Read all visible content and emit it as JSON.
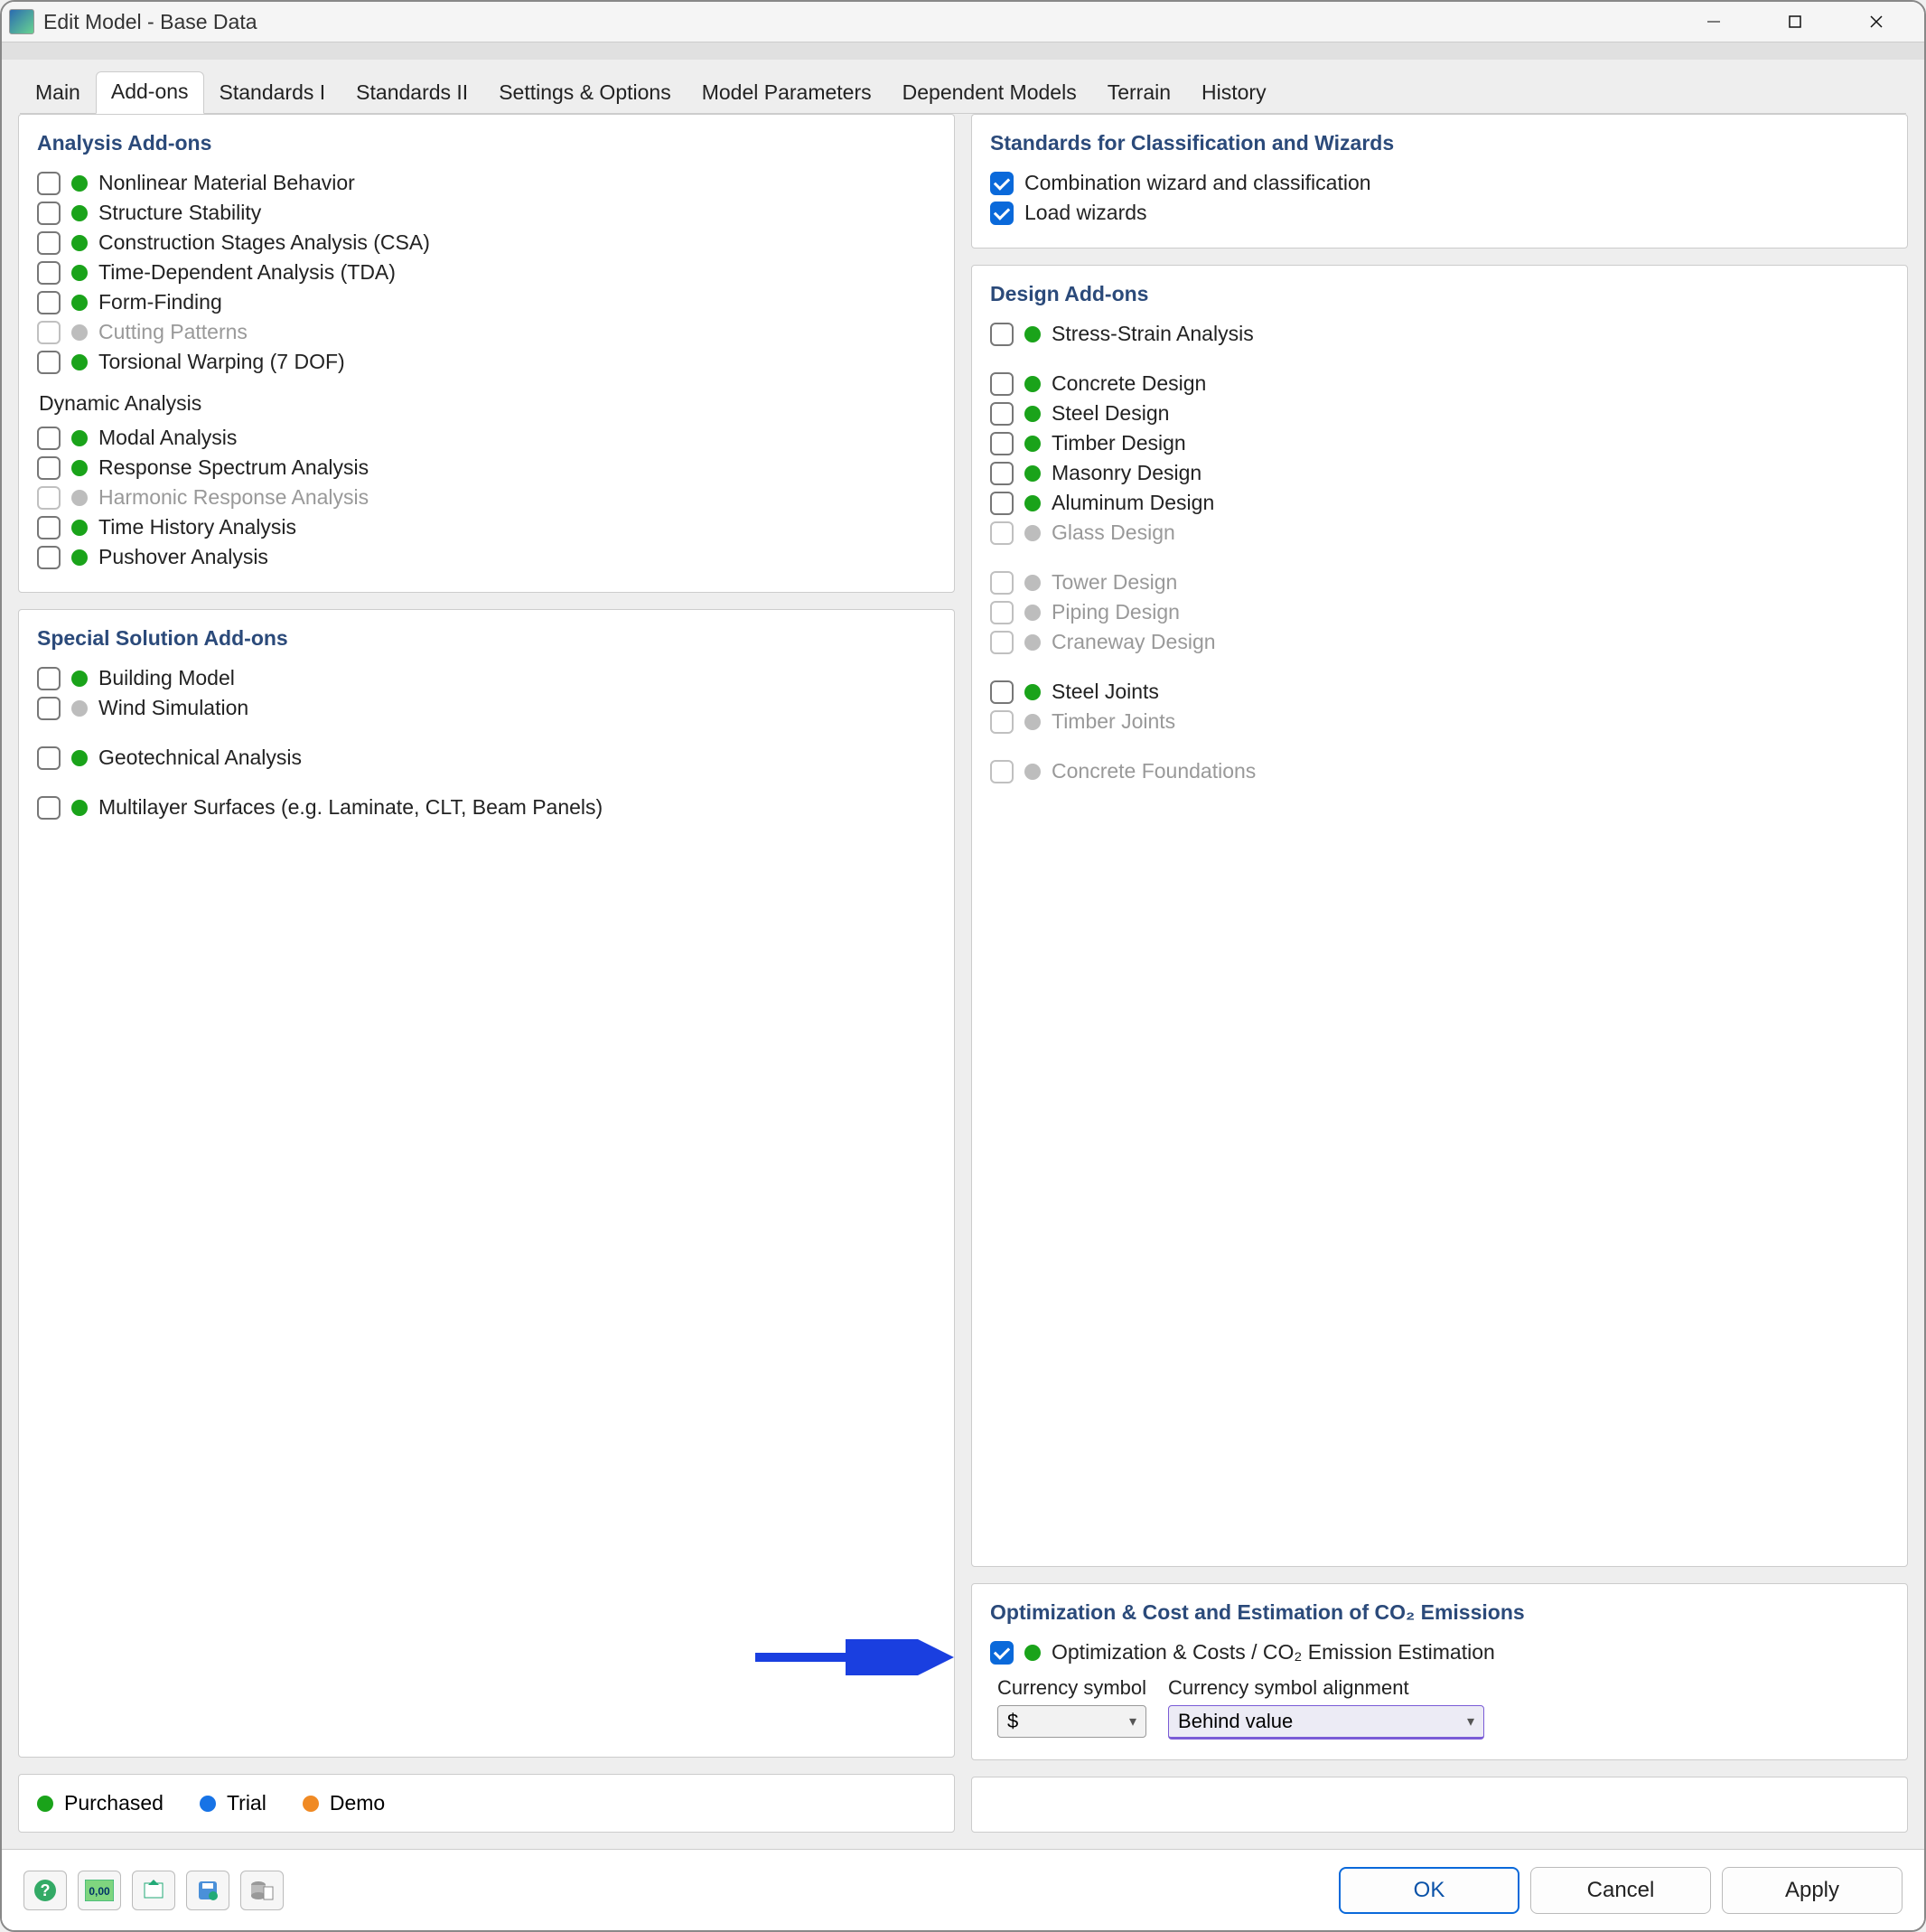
{
  "window": {
    "title": "Edit Model - Base Data"
  },
  "tabs": [
    "Main",
    "Add-ons",
    "Standards I",
    "Standards II",
    "Settings & Options",
    "Model Parameters",
    "Dependent Models",
    "Terrain",
    "History"
  ],
  "active_tab": "Add-ons",
  "panels": {
    "analysis": {
      "title": "Analysis Add-ons",
      "items": [
        {
          "label": "Nonlinear Material Behavior",
          "status": "green",
          "checked": false,
          "disabled": false
        },
        {
          "label": "Structure Stability",
          "status": "green",
          "checked": false,
          "disabled": false
        },
        {
          "label": "Construction Stages Analysis (CSA)",
          "status": "green",
          "checked": false,
          "disabled": false
        },
        {
          "label": "Time-Dependent Analysis (TDA)",
          "status": "green",
          "checked": false,
          "disabled": false
        },
        {
          "label": "Form-Finding",
          "status": "green",
          "checked": false,
          "disabled": false
        },
        {
          "label": "Cutting Patterns",
          "status": "gray",
          "checked": false,
          "disabled": true
        },
        {
          "label": "Torsional Warping (7 DOF)",
          "status": "green",
          "checked": false,
          "disabled": false
        }
      ],
      "dynamic_title": "Dynamic Analysis",
      "dynamic_items": [
        {
          "label": "Modal Analysis",
          "status": "green",
          "checked": false,
          "disabled": false
        },
        {
          "label": "Response Spectrum Analysis",
          "status": "green",
          "checked": false,
          "disabled": false
        },
        {
          "label": "Harmonic Response Analysis",
          "status": "gray",
          "checked": false,
          "disabled": true
        },
        {
          "label": "Time History Analysis",
          "status": "green",
          "checked": false,
          "disabled": false
        },
        {
          "label": "Pushover Analysis",
          "status": "green",
          "checked": false,
          "disabled": false
        }
      ]
    },
    "special": {
      "title": "Special Solution Add-ons",
      "items": [
        {
          "label": "Building Model",
          "status": "green",
          "checked": false,
          "disabled": false
        },
        {
          "label": "Wind Simulation",
          "status": "gray",
          "checked": false,
          "disabled": false
        },
        {
          "label": "",
          "spacer": true
        },
        {
          "label": "Geotechnical Analysis",
          "status": "green",
          "checked": false,
          "disabled": false
        },
        {
          "label": "",
          "spacer": true
        },
        {
          "label": "Multilayer Surfaces (e.g. Laminate, CLT, Beam Panels)",
          "status": "green",
          "checked": false,
          "disabled": false
        }
      ]
    },
    "standards": {
      "title": "Standards for Classification and Wizards",
      "items": [
        {
          "label": "Combination wizard and classification",
          "checked": true
        },
        {
          "label": "Load wizards",
          "checked": true
        }
      ]
    },
    "design": {
      "title": "Design Add-ons",
      "groups": [
        [
          {
            "label": "Stress-Strain Analysis",
            "status": "green",
            "checked": false,
            "disabled": false
          }
        ],
        [
          {
            "label": "Concrete Design",
            "status": "green",
            "checked": false,
            "disabled": false
          },
          {
            "label": "Steel Design",
            "status": "green",
            "checked": false,
            "disabled": false
          },
          {
            "label": "Timber Design",
            "status": "green",
            "checked": false,
            "disabled": false
          },
          {
            "label": "Masonry Design",
            "status": "green",
            "checked": false,
            "disabled": false
          },
          {
            "label": "Aluminum Design",
            "status": "green",
            "checked": false,
            "disabled": false
          },
          {
            "label": "Glass Design",
            "status": "gray",
            "checked": false,
            "disabled": true
          }
        ],
        [
          {
            "label": "Tower Design",
            "status": "gray",
            "checked": false,
            "disabled": true
          },
          {
            "label": "Piping Design",
            "status": "gray",
            "checked": false,
            "disabled": true
          },
          {
            "label": "Craneway Design",
            "status": "gray",
            "checked": false,
            "disabled": true
          }
        ],
        [
          {
            "label": "Steel Joints",
            "status": "green",
            "checked": false,
            "disabled": false
          },
          {
            "label": "Timber Joints",
            "status": "gray",
            "checked": false,
            "disabled": true
          }
        ],
        [
          {
            "label": "Concrete Foundations",
            "status": "gray",
            "checked": false,
            "disabled": true
          }
        ]
      ]
    },
    "optimization": {
      "title": "Optimization & Cost and Estimation of CO₂ Emissions",
      "item": {
        "label": "Optimization & Costs / CO₂ Emission Estimation",
        "status": "green",
        "checked": true,
        "disabled": false
      },
      "currency_label": "Currency symbol",
      "currency_value": "$",
      "alignment_label": "Currency symbol alignment",
      "alignment_value": "Behind value"
    }
  },
  "legend": {
    "purchased": "Purchased",
    "trial": "Trial",
    "demo": "Demo"
  },
  "footer": {
    "ok": "OK",
    "cancel": "Cancel",
    "apply": "Apply"
  }
}
